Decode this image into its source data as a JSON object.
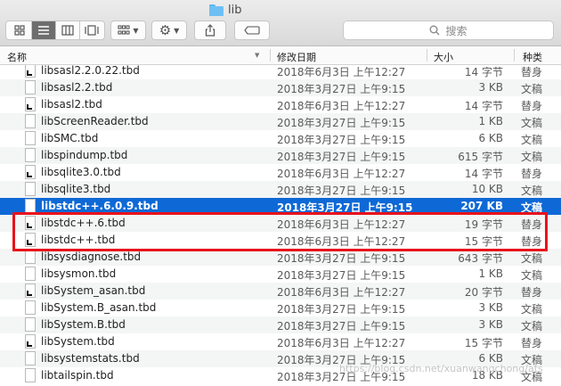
{
  "window": {
    "title": "lib",
    "folder_icon": "folder-icon"
  },
  "toolbar": {
    "view_icons": [
      "icon-view-icon",
      "list-view-icon",
      "column-view-icon",
      "gallery-view-icon"
    ],
    "selected_view": "list-view-icon",
    "group_icon": "group-by-icon",
    "action_icon": "gear-icon",
    "share_icon": "share-icon",
    "tag_icon": "tag-icon",
    "search_placeholder": "搜索"
  },
  "columns": {
    "name": "名称",
    "date": "修改日期",
    "size": "大小",
    "kind": "种类"
  },
  "files": [
    {
      "name": "libsasl2.2.0.22.tbd",
      "date": "2018年6月3日 上午12:27",
      "size": "14 字节",
      "kind": "替身",
      "alias": true
    },
    {
      "name": "libsasl2.2.tbd",
      "date": "2018年3月27日 上午9:15",
      "size": "3 KB",
      "kind": "文稿",
      "alias": false
    },
    {
      "name": "libsasl2.tbd",
      "date": "2018年6月3日 上午12:27",
      "size": "14 字节",
      "kind": "替身",
      "alias": true
    },
    {
      "name": "libScreenReader.tbd",
      "date": "2018年3月27日 上午9:15",
      "size": "1 KB",
      "kind": "文稿",
      "alias": false
    },
    {
      "name": "libSMC.tbd",
      "date": "2018年3月27日 上午9:15",
      "size": "6 KB",
      "kind": "文稿",
      "alias": false
    },
    {
      "name": "libspindump.tbd",
      "date": "2018年3月27日 上午9:15",
      "size": "615 字节",
      "kind": "文稿",
      "alias": false
    },
    {
      "name": "libsqlite3.0.tbd",
      "date": "2018年6月3日 上午12:27",
      "size": "14 字节",
      "kind": "替身",
      "alias": true
    },
    {
      "name": "libsqlite3.tbd",
      "date": "2018年3月27日 上午9:15",
      "size": "10 KB",
      "kind": "文稿",
      "alias": false
    },
    {
      "name": "libstdc++.6.0.9.tbd",
      "date": "2018年3月27日 上午9:15",
      "size": "207 KB",
      "kind": "文稿",
      "alias": false,
      "selected": true
    },
    {
      "name": "libstdc++.6.tbd",
      "date": "2018年6月3日 上午12:27",
      "size": "19 字节",
      "kind": "替身",
      "alias": true
    },
    {
      "name": "libstdc++.tbd",
      "date": "2018年6月3日 上午12:27",
      "size": "15 字节",
      "kind": "替身",
      "alias": true
    },
    {
      "name": "libsysdiagnose.tbd",
      "date": "2018年3月27日 上午9:15",
      "size": "643 字节",
      "kind": "文稿",
      "alias": false
    },
    {
      "name": "libsysmon.tbd",
      "date": "2018年3月27日 上午9:15",
      "size": "1 KB",
      "kind": "文稿",
      "alias": false
    },
    {
      "name": "libSystem_asan.tbd",
      "date": "2018年6月3日 上午12:27",
      "size": "20 字节",
      "kind": "替身",
      "alias": true
    },
    {
      "name": "libSystem.B_asan.tbd",
      "date": "2018年3月27日 上午9:15",
      "size": "3 KB",
      "kind": "文稿",
      "alias": false
    },
    {
      "name": "libSystem.B.tbd",
      "date": "2018年3月27日 上午9:15",
      "size": "3 KB",
      "kind": "文稿",
      "alias": false
    },
    {
      "name": "libSystem.tbd",
      "date": "2018年6月3日 上午12:27",
      "size": "15 字节",
      "kind": "替身",
      "alias": true
    },
    {
      "name": "libsystemstats.tbd",
      "date": "2018年3月27日 上午9:15",
      "size": "6 KB",
      "kind": "文稿",
      "alias": false
    },
    {
      "name": "libtailspin.tbd",
      "date": "2018年3月27日 上午9:15",
      "size": "18 KB",
      "kind": "文稿",
      "alias": false
    }
  ],
  "watermark": "https://blog.csdn.net/xuanwangchong/ats",
  "colors": {
    "selection": "#0e69d6",
    "highlight_border": "#e8121b",
    "folder": "#6ec0f4"
  }
}
